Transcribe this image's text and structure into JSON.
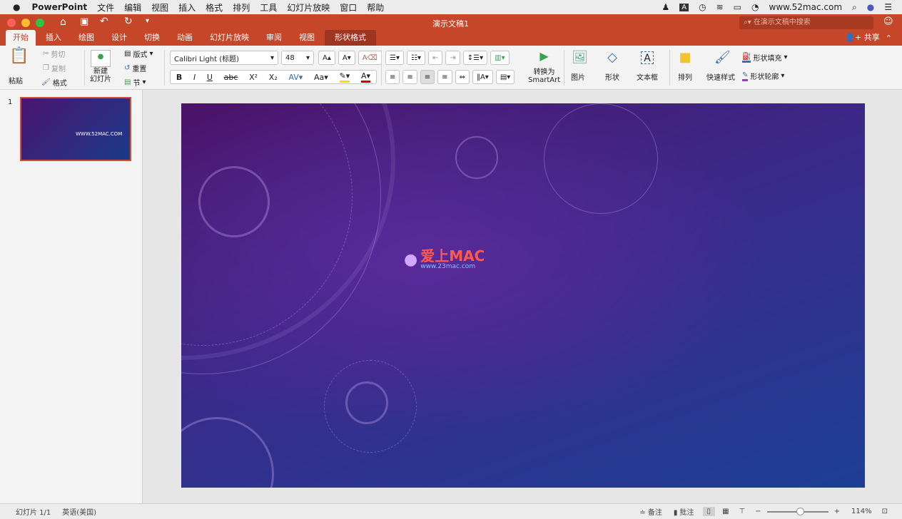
{
  "menubar": {
    "apple": "",
    "app": "PowerPoint",
    "items": [
      "文件",
      "编辑",
      "视图",
      "插入",
      "格式",
      "排列",
      "工具",
      "幻灯片放映",
      "窗口",
      "帮助"
    ],
    "url": "www.52mac.com"
  },
  "title": "演示文稿1",
  "search_placeholder": "在演示文稿中搜索",
  "share": "共享",
  "tabs": [
    "开始",
    "插入",
    "绘图",
    "设计",
    "切换",
    "动画",
    "幻灯片放映",
    "审阅",
    "视图",
    "形状格式"
  ],
  "ribbon": {
    "paste": "粘贴",
    "cut": "剪切",
    "copy": "复制",
    "format": "格式",
    "new_slide": "新建\n幻灯片",
    "layout": "版式",
    "reset": "重置",
    "section": "节",
    "font": "Calibri Light (标题)",
    "size": "48",
    "convert": "转换为",
    "smartart": "SmartArt",
    "picture": "图片",
    "shape": "形状",
    "textbox": "文本框",
    "arrange": "排列",
    "quick_styles": "快速样式",
    "shape_fill": "形状填充",
    "shape_outline": "形状轮廓"
  },
  "thumb": {
    "num": "1",
    "text": "WWW.52MAC.COM"
  },
  "slide": {
    "logo": "爱上MAC",
    "logo_url": "www.23mac.com"
  },
  "status": {
    "slide": "幻灯片 1/1",
    "lang": "英语(美国)",
    "notes": "备注",
    "comments": "批注",
    "zoom": "114%",
    "zoom_fraction": 0.55
  },
  "colors": {
    "accent": "#c6462a"
  }
}
